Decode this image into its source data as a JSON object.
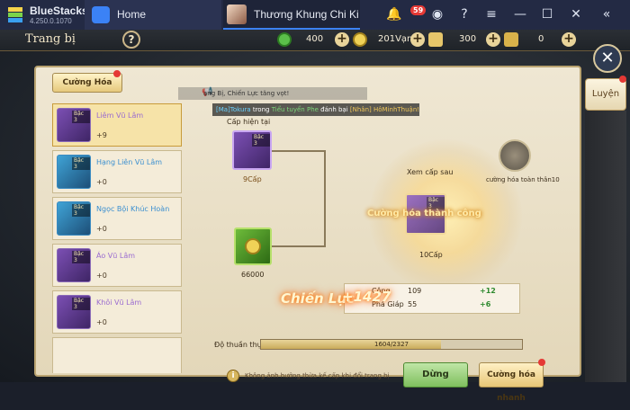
{
  "bluestacks": {
    "name": "BlueStacks",
    "version": "4.250.0.1070",
    "home_tab": "Home",
    "game_tab": "Thương Khung Chi Ki",
    "notifications": "59"
  },
  "game": {
    "title": "Trang bị",
    "currencies": [
      {
        "value": "400"
      },
      {
        "value": "201Vạn"
      },
      {
        "value": "300"
      },
      {
        "value": "0"
      }
    ],
    "side_tab": "Luyện",
    "enhance_tab": "Cường Hóa",
    "news": {
      "line1": "ang Bị, Chiến Lực tăng vọt!",
      "line2_prefix": "[Ma]",
      "line2_name": "Tokura",
      "line2_mid1": " trong ",
      "line2_event": "Tiểu tuyển Phe",
      "line2_mid2": " đánh bại ",
      "line2_target": "[Nhân] HôMinhThuận!"
    },
    "items": [
      {
        "tier": "Bậc 3",
        "name": "Liêm Vũ Lâm",
        "level": "+9",
        "color": "purple"
      },
      {
        "tier": "Bậc 3",
        "name": "Hạng Liên Vũ Lâm",
        "level": "+0",
        "color": "blue"
      },
      {
        "tier": "Bậc 3",
        "name": "Ngọc Bội Khúc Hoàn",
        "level": "+0",
        "color": "blue"
      },
      {
        "tier": "Bậc 3",
        "name": "Áo Vũ Lâm",
        "level": "+0",
        "color": "purple"
      },
      {
        "tier": "Bậc 3",
        "name": "Khôi Vũ Lâm",
        "level": "+0",
        "color": "purple"
      }
    ],
    "current_level_label": "Cấp hiện tại",
    "current_tier": "Bậc 3",
    "current_level": "9Cấp",
    "gold_cost": "66000",
    "next_level_label": "Xem cấp sau",
    "next_tier": "Bậc 3",
    "next_level": "10Cấp",
    "glow_text": "Cường hóa thành công",
    "stats": [
      {
        "name": "Công",
        "value": "109",
        "plus": "+12"
      },
      {
        "name": "Phá Giáp",
        "value": "55",
        "plus": "+6"
      }
    ],
    "power_label": "Chiến Lực",
    "power_value": "+1427",
    "all_enhance_label": "cường hóa toàn thân10",
    "proficiency_label": "Độ thuần thục:",
    "proficiency_text": "1604/2327",
    "proficiency_fraction": 0.689,
    "note": "Không ảnh hưởng thừa kế cấp khi đổi trang bị",
    "stop_button": "Dừng",
    "fast_button": "Cường hóa nhanh"
  }
}
